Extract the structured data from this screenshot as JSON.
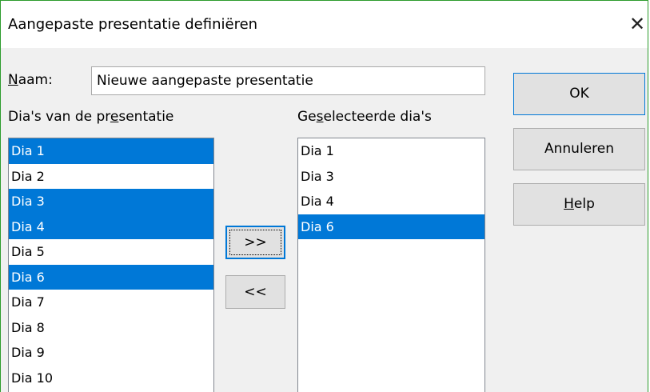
{
  "window": {
    "title": "Aangepaste presentatie definiëren",
    "close_glyph": "✕"
  },
  "name": {
    "label_accel": "N",
    "label_rest": "aam:",
    "value": "Nieuwe aangepaste presentatie"
  },
  "source": {
    "label_pre": "Dia's van de pr",
    "label_accel": "e",
    "label_post": "sentatie",
    "items": [
      {
        "label": "Dia 1",
        "selected": true
      },
      {
        "label": "Dia 2",
        "selected": false
      },
      {
        "label": "Dia 3",
        "selected": true
      },
      {
        "label": "Dia 4",
        "selected": true
      },
      {
        "label": "Dia 5",
        "selected": false
      },
      {
        "label": "Dia 6",
        "selected": true
      },
      {
        "label": "Dia 7",
        "selected": false
      },
      {
        "label": "Dia 8",
        "selected": false
      },
      {
        "label": "Dia 9",
        "selected": false
      },
      {
        "label": "Dia 10",
        "selected": false
      }
    ]
  },
  "selected": {
    "label_pre": "Ge",
    "label_accel": "s",
    "label_post": "electeerde dia's",
    "items": [
      {
        "label": "Dia 1",
        "selected": false
      },
      {
        "label": "Dia 3",
        "selected": false
      },
      {
        "label": "Dia 4",
        "selected": false
      },
      {
        "label": "Dia 6",
        "selected": true
      }
    ]
  },
  "buttons": {
    "add": ">>",
    "remove": "<<",
    "ok": "OK",
    "cancel": "Annuleren",
    "help_accel": "H",
    "help_rest": "elp"
  },
  "colors": {
    "selection": "#0078d7",
    "window_border": "#2e9c2e"
  }
}
